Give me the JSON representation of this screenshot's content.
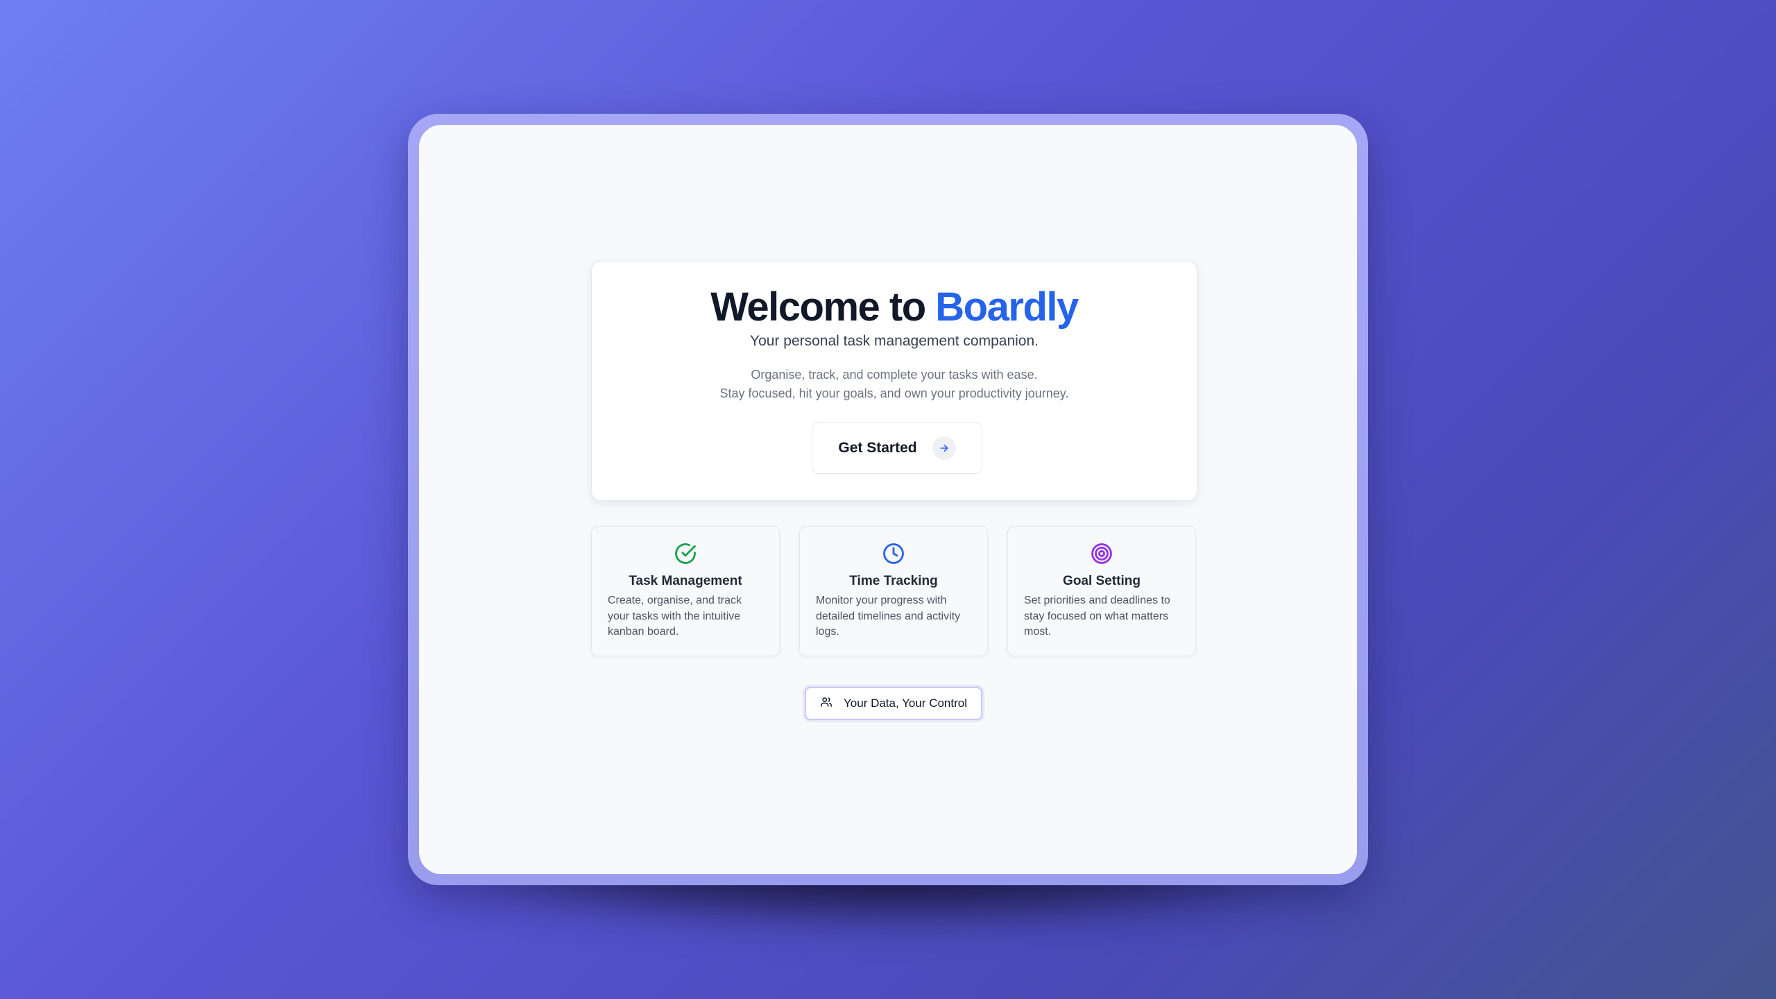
{
  "hero": {
    "title_prefix": "Welcome to",
    "title_brand": "Boardly",
    "subtitle": "Your personal task management companion.",
    "description_line1": "Organise, track, and complete your tasks with ease.",
    "description_line2": "Stay focused, hit your goals, and own your productivity journey.",
    "cta_label": "Get Started",
    "cta_icon": "arrow-right-icon"
  },
  "features": [
    {
      "title": "Task Management",
      "description": "Create, organise, and track your tasks with the intuitive kanban board.",
      "icon": "check-circle-icon",
      "color": "#16a34a"
    },
    {
      "title": "Time Tracking",
      "description": "Monitor your progress with detailed timelines and activity logs.",
      "icon": "clock-icon",
      "color": "#2563eb"
    },
    {
      "title": "Goal Setting",
      "description": "Set priorities and deadlines to stay focused on what matters most.",
      "icon": "target-icon",
      "color": "#9333ea"
    }
  ],
  "badge": {
    "label": "Your Data, Your Control",
    "icon": "users-icon"
  },
  "colors": {
    "brand": "#2563eb",
    "background_start": "#6e7ff3",
    "background_end": "#43558f",
    "frame": "#a5a6f6"
  }
}
